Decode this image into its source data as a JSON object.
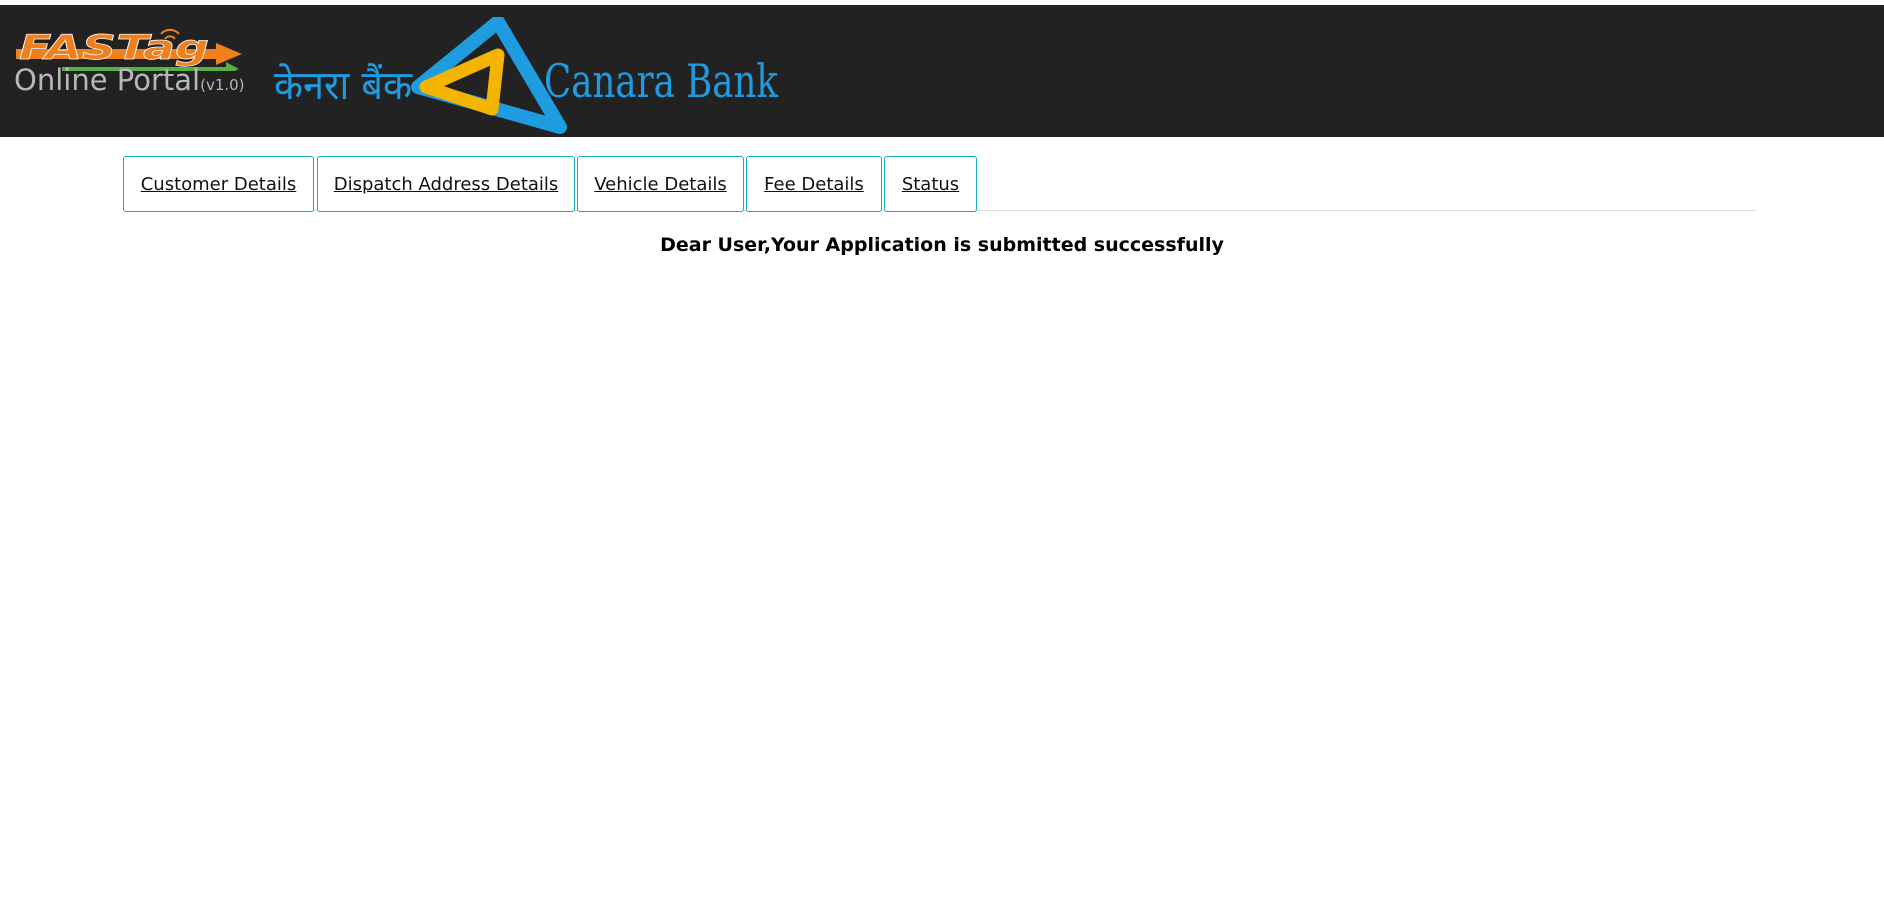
{
  "header": {
    "fastag_logo": "FASTag",
    "portal_title": "Online Portal",
    "portal_version": "(v1.0)",
    "bank_hindi_name": "केनरा बैंक",
    "bank_name": "Canara Bank"
  },
  "tabs": [
    {
      "label": "Customer Details"
    },
    {
      "label": "Dispatch Address Details"
    },
    {
      "label": "Vehicle Details"
    },
    {
      "label": "Fee Details"
    },
    {
      "label": "Status"
    }
  ],
  "main": {
    "message": "Dear User,Your Application is submitted successfully"
  },
  "colors": {
    "header_bg": "#222222",
    "tab_border": "#17a9c6",
    "canara_blue": "#1f9be0",
    "canara_yellow": "#f4b400",
    "fastag_orange": "#f07f1d",
    "fastag_green": "#58b947"
  }
}
